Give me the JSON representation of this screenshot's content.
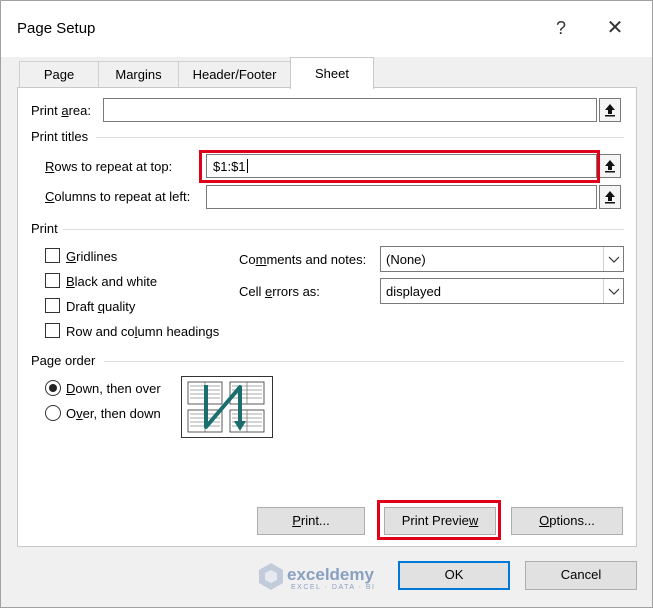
{
  "window": {
    "title": "Page Setup",
    "help_glyph": "?",
    "close_glyph": "✕"
  },
  "tabs": [
    {
      "label": "Page",
      "active": false
    },
    {
      "label": "Margins",
      "active": false
    },
    {
      "label": "Header/Footer",
      "active": false
    },
    {
      "label": "Sheet",
      "active": true
    }
  ],
  "print_area": {
    "label_pre": "Print ",
    "label_u": "a",
    "label_post": "rea:",
    "value": ""
  },
  "print_titles": {
    "header": "Print titles",
    "rows_label_u": "R",
    "rows_label_post": "ows to repeat at top:",
    "rows_value": "$1:$1",
    "cols_label_u": "C",
    "cols_label_post": "olumns to repeat at left:",
    "cols_value": ""
  },
  "print": {
    "header": "Print",
    "checkboxes": [
      {
        "pre": "",
        "u": "G",
        "post": "ridlines",
        "checked": false
      },
      {
        "pre": "",
        "u": "B",
        "post": "lack and white",
        "checked": false
      },
      {
        "pre": "Draft ",
        "u": "q",
        "post": "uality",
        "checked": false
      },
      {
        "pre": "Row and co",
        "u": "l",
        "post": "umn headings",
        "checked": false
      }
    ],
    "comments_label_pre": "Co",
    "comments_label_u": "m",
    "comments_label_post": "ments and notes:",
    "comments_value": "(None)",
    "errors_label_pre": "Cell ",
    "errors_label_u": "e",
    "errors_label_post": "rrors as:",
    "errors_value": "displayed"
  },
  "page_order": {
    "header": "Page order",
    "options": [
      {
        "pre": "",
        "u": "D",
        "post": "own, then over",
        "selected": true
      },
      {
        "pre": "O",
        "u": "v",
        "post": "er, then down",
        "selected": false
      }
    ]
  },
  "buttons": {
    "print_u": "P",
    "print_post": "rint...",
    "preview_pre": "Print Previe",
    "preview_u": "w",
    "preview_post": "",
    "options_u": "O",
    "options_post": "ptions...",
    "ok": "OK",
    "cancel": "Cancel"
  },
  "watermark": {
    "text": "exceldemy",
    "subtext": "EXCEL · DATA · BI"
  },
  "colors": {
    "highlight": "#e0001a",
    "accent": "#0078d7",
    "arrow": "#1a6e6e"
  }
}
